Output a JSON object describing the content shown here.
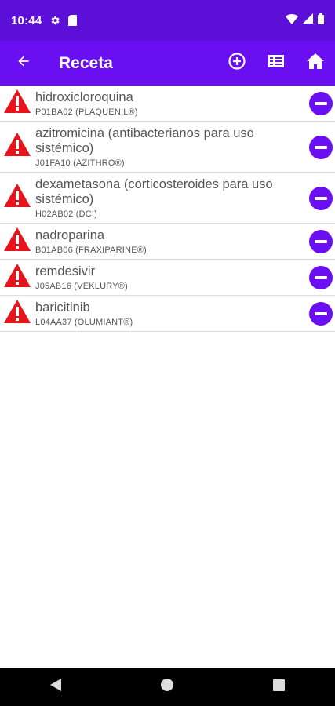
{
  "status_bar": {
    "time": "10:44",
    "icons": [
      "settings-icon",
      "sd-card-icon",
      "wifi-icon",
      "signal-icon",
      "battery-icon"
    ]
  },
  "app_bar": {
    "title": "Receta",
    "back_icon": "arrow-back-icon",
    "actions": [
      "add-circle-icon",
      "list-view-icon",
      "home-icon"
    ],
    "color": "#6a0ff2"
  },
  "items": [
    {
      "name": "hidroxicloroquina",
      "code": "P01BA02  (PLAQUENIL®)"
    },
    {
      "name": "azitromicina (antibacterianos para uso sistémico)",
      "code": "J01FA10  (AZITHRO®)"
    },
    {
      "name": "dexametasona (corticosteroides para uso sistémico)",
      "code": "H02AB02  (DCI)"
    },
    {
      "name": "nadroparina",
      "code": "B01AB06  (FRAXIPARINE®)"
    },
    {
      "name": "remdesivir",
      "code": "J05AB16 (VEKLURY®)"
    },
    {
      "name": "baricitinib",
      "code": "L04AA37 (OLUMIANT®)"
    }
  ],
  "item_icons": {
    "warning": "warning-icon",
    "remove": "remove-circle-icon"
  },
  "colors": {
    "warning": "#e8141b",
    "accent": "#6a0ff2",
    "status_bar": "#5c0fd6"
  },
  "nav_bar": {
    "icons": [
      "back-triangle-icon",
      "home-circle-icon",
      "recents-square-icon"
    ]
  }
}
